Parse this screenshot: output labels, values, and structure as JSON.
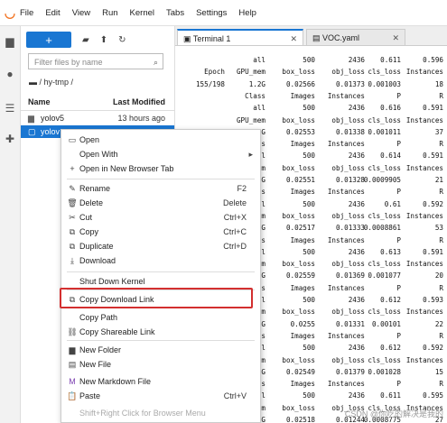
{
  "menubar": {
    "items": [
      "File",
      "Edit",
      "View",
      "Run",
      "Kernel",
      "Tabs",
      "Settings",
      "Help"
    ]
  },
  "sidebar": {
    "icons": [
      "folder-icon",
      "running-icon",
      "commands-icon",
      "extension-icon"
    ]
  },
  "filebrowser": {
    "new_label": "+",
    "filter_placeholder": "Filter files by name",
    "breadcrumb": "/ hy-tmp /",
    "col_name": "Name",
    "col_modified": "Last Modified",
    "rows": [
      {
        "name": "yolov5",
        "modified": "13 hours ago"
      },
      {
        "name": "yolov",
        "modified": ""
      }
    ]
  },
  "tabs": [
    {
      "label": "Terminal 1"
    },
    {
      "label": "VOC.yaml"
    }
  ],
  "terminal": {
    "columns": [
      "Epoch",
      "GPU_mem",
      "box_loss",
      "obj_loss",
      "cls_loss",
      "Instances"
    ],
    "lines": [
      [
        "",
        "all",
        "500",
        "2436",
        "0.611",
        "0.596"
      ],
      [
        "Epoch",
        "GPU_mem",
        "box_loss",
        "obj_loss",
        "cls_loss",
        "Instances"
      ],
      [
        "155/198",
        "1.2G",
        "0.02566",
        "0.01373",
        "0.001003",
        "18"
      ],
      [
        "",
        "Class",
        "Images",
        "Instances",
        "P",
        "R"
      ],
      [
        "",
        "all",
        "500",
        "2436",
        "0.616",
        "0.591"
      ],
      [
        "",
        "GPU_mem",
        "box_loss",
        "obj_loss",
        "cls_loss",
        "Instances"
      ],
      [
        "",
        "2G",
        "0.02553",
        "0.01338",
        "0.001011",
        "37"
      ],
      [
        "",
        "lass",
        "Images",
        "Instances",
        "P",
        "R"
      ],
      [
        "",
        "all",
        "500",
        "2436",
        "0.614",
        "0.591"
      ],
      [
        "",
        "mem",
        "box_loss",
        "obj_loss",
        "cls_loss",
        "Instances"
      ],
      [
        "",
        "2G",
        "0.02551",
        "0.01328",
        "0.0009905",
        "21"
      ],
      [
        "",
        "ass",
        "Images",
        "Instances",
        "P",
        "R"
      ],
      [
        "",
        "all",
        "500",
        "2436",
        "0.61",
        "0.592"
      ],
      [
        "",
        "mem",
        "box_loss",
        "obj_loss",
        "cls_loss",
        "Instances"
      ],
      [
        "",
        "2G",
        "0.02517",
        "0.01333",
        "0.0008861",
        "53"
      ],
      [
        "",
        "ass",
        "Images",
        "Instances",
        "P",
        "R"
      ],
      [
        "",
        "all",
        "500",
        "2436",
        "0.613",
        "0.591"
      ],
      [
        "",
        "mem",
        "box_loss",
        "obj_loss",
        "cls_loss",
        "Instances"
      ],
      [
        "",
        "2G",
        "0.02559",
        "0.01369",
        "0.001077",
        "20"
      ],
      [
        "",
        "ass",
        "Images",
        "Instances",
        "P",
        "R"
      ],
      [
        "",
        "all",
        "500",
        "2436",
        "0.612",
        "0.593"
      ],
      [
        "",
        "mem",
        "box_loss",
        "obj_loss",
        "cls_loss",
        "Instances"
      ],
      [
        "",
        "2G",
        "0.0255",
        "0.01331",
        "0.00101",
        "22"
      ],
      [
        "",
        "ass",
        "Images",
        "Instances",
        "P",
        "R"
      ],
      [
        "",
        "all",
        "500",
        "2436",
        "0.612",
        "0.592"
      ],
      [
        "",
        "mem",
        "box_loss",
        "obj_loss",
        "cls_loss",
        "Instances"
      ],
      [
        "",
        "2G",
        "0.02549",
        "0.01379",
        "0.001028",
        "15"
      ],
      [
        "",
        "ass",
        "Images",
        "Instances",
        "P",
        "R"
      ],
      [
        "",
        "all",
        "500",
        "2436",
        "0.611",
        "0.595"
      ],
      [
        "",
        "mem",
        "box_loss",
        "obj_loss",
        "cls_loss",
        "Instances"
      ],
      [
        "",
        "2G",
        "0.02518",
        "0.01244",
        "0.0008775",
        "27"
      ]
    ]
  },
  "context_menu": {
    "items": [
      {
        "label": "Open",
        "shortcut": "",
        "icon": "open-icon"
      },
      {
        "label": "Open With",
        "shortcut": "",
        "icon": "",
        "arrow": "▸"
      },
      {
        "label": "Open in New Browser Tab",
        "shortcut": "",
        "icon": "new-tab-icon"
      },
      {
        "label": "Rename",
        "shortcut": "F2",
        "icon": "edit-icon"
      },
      {
        "label": "Delete",
        "shortcut": "Delete",
        "icon": "trash-icon"
      },
      {
        "label": "Cut",
        "shortcut": "Ctrl+X",
        "icon": "scissors-icon"
      },
      {
        "label": "Copy",
        "shortcut": "Ctrl+C",
        "icon": "copy-icon"
      },
      {
        "label": "Duplicate",
        "shortcut": "Ctrl+D",
        "icon": "duplicate-icon"
      },
      {
        "label": "Download",
        "shortcut": "",
        "icon": "download-icon"
      },
      {
        "label": "Shut Down Kernel",
        "shortcut": "",
        "icon": ""
      },
      {
        "label": "Copy Download Link",
        "shortcut": "",
        "icon": "link-icon"
      },
      {
        "label": "Copy Path",
        "shortcut": "",
        "icon": ""
      },
      {
        "label": "Copy Shareable Link",
        "shortcut": "",
        "icon": "share-icon"
      },
      {
        "label": "New Folder",
        "shortcut": "",
        "icon": "new-folder-icon"
      },
      {
        "label": "New File",
        "shortcut": "",
        "icon": "new-file-icon"
      },
      {
        "label": "New Markdown File",
        "shortcut": "",
        "icon": "markdown-icon"
      },
      {
        "label": "Paste",
        "shortcut": "Ctrl+V",
        "icon": "paste-icon"
      },
      {
        "label": "Shift+Right Click for Browser Menu",
        "shortcut": "",
        "icon": ""
      }
    ]
  },
  "watermark": "CSDN @你吃的解决是我的",
  "colors": {
    "accent": "#1976d2",
    "highlight": "#d32f2f",
    "logo": "#f37626"
  }
}
